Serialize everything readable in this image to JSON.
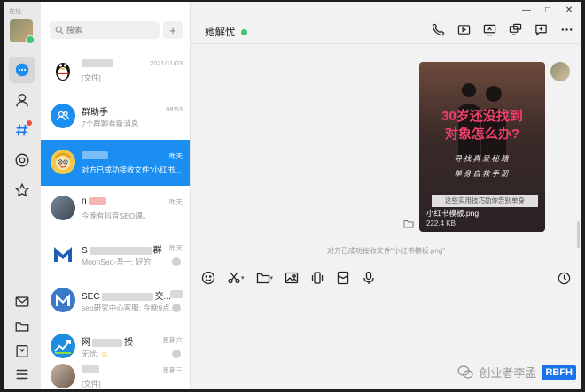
{
  "rail": {
    "label": "在线",
    "items": [
      {
        "icon": "chat-bubble-icon",
        "active": true
      },
      {
        "icon": "contact-person-icon"
      },
      {
        "icon": "hashtag-icon",
        "badge": true
      },
      {
        "icon": "at-circle-icon"
      },
      {
        "icon": "star-icon"
      }
    ],
    "bottom_items": [
      "mail-icon",
      "folder-icon",
      "bookmark-icon",
      "menu-icon"
    ]
  },
  "search": {
    "placeholder": "搜索",
    "add_label": "+"
  },
  "conversations": [
    {
      "name": "",
      "time": "2021/11/03",
      "msg": "[文件]",
      "avatar": "qq-penguin"
    },
    {
      "name": "群助手",
      "time": "08:53",
      "msg": "7个群聊有新消息",
      "avatar": "group"
    },
    {
      "name": "",
      "time": "昨天",
      "msg": "对方已成功接收文件\"小红书...",
      "avatar": "cartoon",
      "active": true
    },
    {
      "name": "n",
      "time": "昨天",
      "msg": "今晚有抖音SEO课。",
      "avatar": "photo"
    },
    {
      "name": "S",
      "name_suffix": "群",
      "time": "昨天",
      "msg": "MoonSeo-吾一: 好的",
      "avatar": "moonseo"
    },
    {
      "name": "SEC",
      "name_suffix": "交...",
      "time": "昨天",
      "msg": "seo研究中心客服: 今晚9点...",
      "avatar": "seo-m"
    },
    {
      "name": "网",
      "name_suffix": "授",
      "time": "星期六",
      "msg": "无忧:",
      "avatar": "chart"
    },
    {
      "name": "",
      "time": "星期三",
      "msg": "[文件]",
      "avatar": "photo2"
    }
  ],
  "chat": {
    "title": "她解忧",
    "window_controls": [
      "—",
      "□",
      "✕"
    ],
    "header_icons": [
      "phone-icon",
      "video-icon",
      "screen-share-icon",
      "remote-desktop-icon",
      "new-chat-icon",
      "more-icon"
    ],
    "file": {
      "headline1": "30岁还没找到",
      "headline2": "对象怎么办?",
      "sub1": "寻找真爱秘籍",
      "sub2": "单身自救手册",
      "strip_text": "这些实用技巧助你告别单身",
      "name": "小红书模板.png",
      "size": "222.4 KB"
    },
    "system_message": "对方已成功接收文件\"小红书模板.png\"",
    "toolbar_icons": [
      "emoji-icon",
      "scissors-icon",
      "folder-icon",
      "image-icon",
      "vibrate-icon",
      "gift-icon",
      "mic-icon"
    ],
    "history_icon": "clock-icon"
  },
  "watermark": {
    "text": "创业者李孟",
    "logo": "RBFH"
  }
}
